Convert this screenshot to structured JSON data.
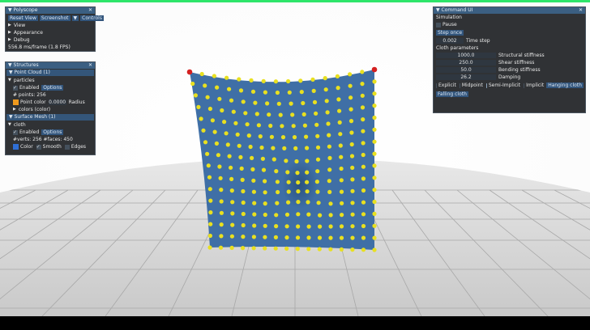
{
  "polyscope": {
    "title": "Polyscope",
    "reset_view": "Reset View",
    "screenshot": "Screenshot",
    "controls": "Controls",
    "view": "View",
    "appearance": "Appearance",
    "debug": "Debug",
    "fps": "556.8 ms/frame (1.8 FPS)"
  },
  "structures": {
    "title": "Structures",
    "point_cloud_header": "Point Cloud (1)",
    "particles_label": "particles",
    "enabled": "Enabled",
    "options": "Options",
    "points_count": "# points: 256",
    "point_color": "Point color",
    "radius_value": "0.0000",
    "radius_label": "Radius",
    "colors_label": "colors (color)",
    "surface_mesh_header": "Surface Mesh (1)",
    "cloth_label": "cloth",
    "verts_faces": "#verts: 256  #faces: 450",
    "color_label": "Color",
    "smooth_label": "Smooth",
    "edges_label": "Edges",
    "point_swatch": "#f09a1e",
    "mesh_swatch": "#2f6fd6"
  },
  "command": {
    "title": "Command UI",
    "simulation_label": "Simulation",
    "pause": "Pause",
    "step_once": "Step once",
    "time_step_value": "0.002",
    "time_step_label": "Time step",
    "cloth_params": "Cloth parameters",
    "params": [
      {
        "value": "1000.0",
        "label": "Structural stiffness"
      },
      {
        "value": "250.0",
        "label": "Shear stiffness"
      },
      {
        "value": "50.0",
        "label": "Bending stiffness"
      },
      {
        "value": "26.2",
        "label": "Damping"
      }
    ],
    "integrators": [
      {
        "label": "Explicit",
        "on": false
      },
      {
        "label": "Midpoint",
        "on": false
      },
      {
        "label": "Semi-Implicit",
        "on": true
      },
      {
        "label": "Implicit",
        "on": false
      }
    ],
    "hanging_cloth": "Hanging cloth",
    "falling_cloth": "Falling cloth"
  },
  "scene": {
    "cloth_color": "#3f6fa6",
    "particle_color": "#e8e020",
    "pin_color": "#d42020",
    "floor_color": "#d8d8d8",
    "grid_color": "#a9a9a9"
  }
}
